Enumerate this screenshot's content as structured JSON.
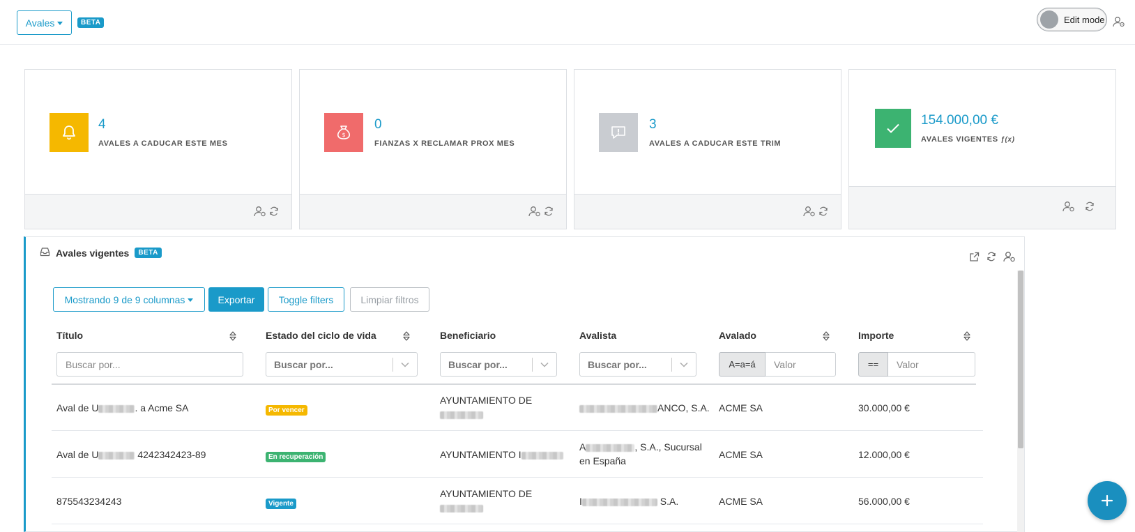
{
  "header": {
    "module_label": "Avales",
    "beta": "BETA",
    "edit_mode": "Edit mode"
  },
  "kpis": [
    {
      "value": "4",
      "label": "AVALES A CADUCAR ESTE MES",
      "icon": "bell-icon",
      "color": "#f5b800"
    },
    {
      "value": "0",
      "label": "FIANZAS X RECLAMAR PROX MES",
      "icon": "money-bag-icon",
      "color": "#f06b6b"
    },
    {
      "value": "3",
      "label": "AVALES A CADUCAR ESTE TRIM",
      "icon": "alert-comment-icon",
      "color": "#c9ccd1"
    },
    {
      "value": "154.000,00 €",
      "label": "AVALES VIGENTES",
      "fx": "ƒ(x)",
      "icon": "check-icon",
      "color": "#3cb371"
    }
  ],
  "panel": {
    "title": "Avales vigentes",
    "beta": "BETA",
    "buttons": {
      "columns": "Mostrando 9 de 9 columnas",
      "export": "Exportar",
      "toggle": "Toggle filters",
      "clear": "Limpiar filtros"
    },
    "columns": {
      "titulo": "Título",
      "estado": "Estado del ciclo de vida",
      "beneficiario": "Beneficiario",
      "avalista": "Avalista",
      "avalado": "Avalado",
      "importe": "Importe"
    },
    "filters": {
      "search_placeholder": "Buscar por...",
      "select_placeholder": "Buscar por...",
      "text_op": "A=a=á",
      "num_op": "==",
      "value_placeholder": "Valor"
    },
    "rows": [
      {
        "titulo_a": "Aval de U",
        "titulo_b": ". a Acme SA",
        "estado": "Por vencer",
        "estado_color": "#f5b800",
        "beneficiario": "AYUNTAMIENTO DE",
        "avalista_a": "",
        "avalista_b": "ANCO, S.A.",
        "avalado": "ACME SA",
        "importe": "30.000,00 €"
      },
      {
        "titulo_a": "Aval de U",
        "titulo_b": " 4242342423-89",
        "estado": "En recuperación",
        "estado_color": "#3cb371",
        "beneficiario": "AYUNTAMIENTO I",
        "avalista_a": "A",
        "avalista_b": ", S.A., Sucursal",
        "avalista_c": "en España",
        "avalado": "ACME SA",
        "importe": "12.000,00 €"
      },
      {
        "titulo_a": "875543234243",
        "titulo_b": "",
        "estado": "Vigente",
        "estado_color": "#1a9ac9",
        "beneficiario": "AYUNTAMIENTO DE",
        "avalista_a": "I",
        "avalista_b": " S.A.",
        "avalado": "ACME SA",
        "importe": "56.000,00 €"
      }
    ]
  },
  "colors": {
    "primary": "#1a9ac9"
  }
}
